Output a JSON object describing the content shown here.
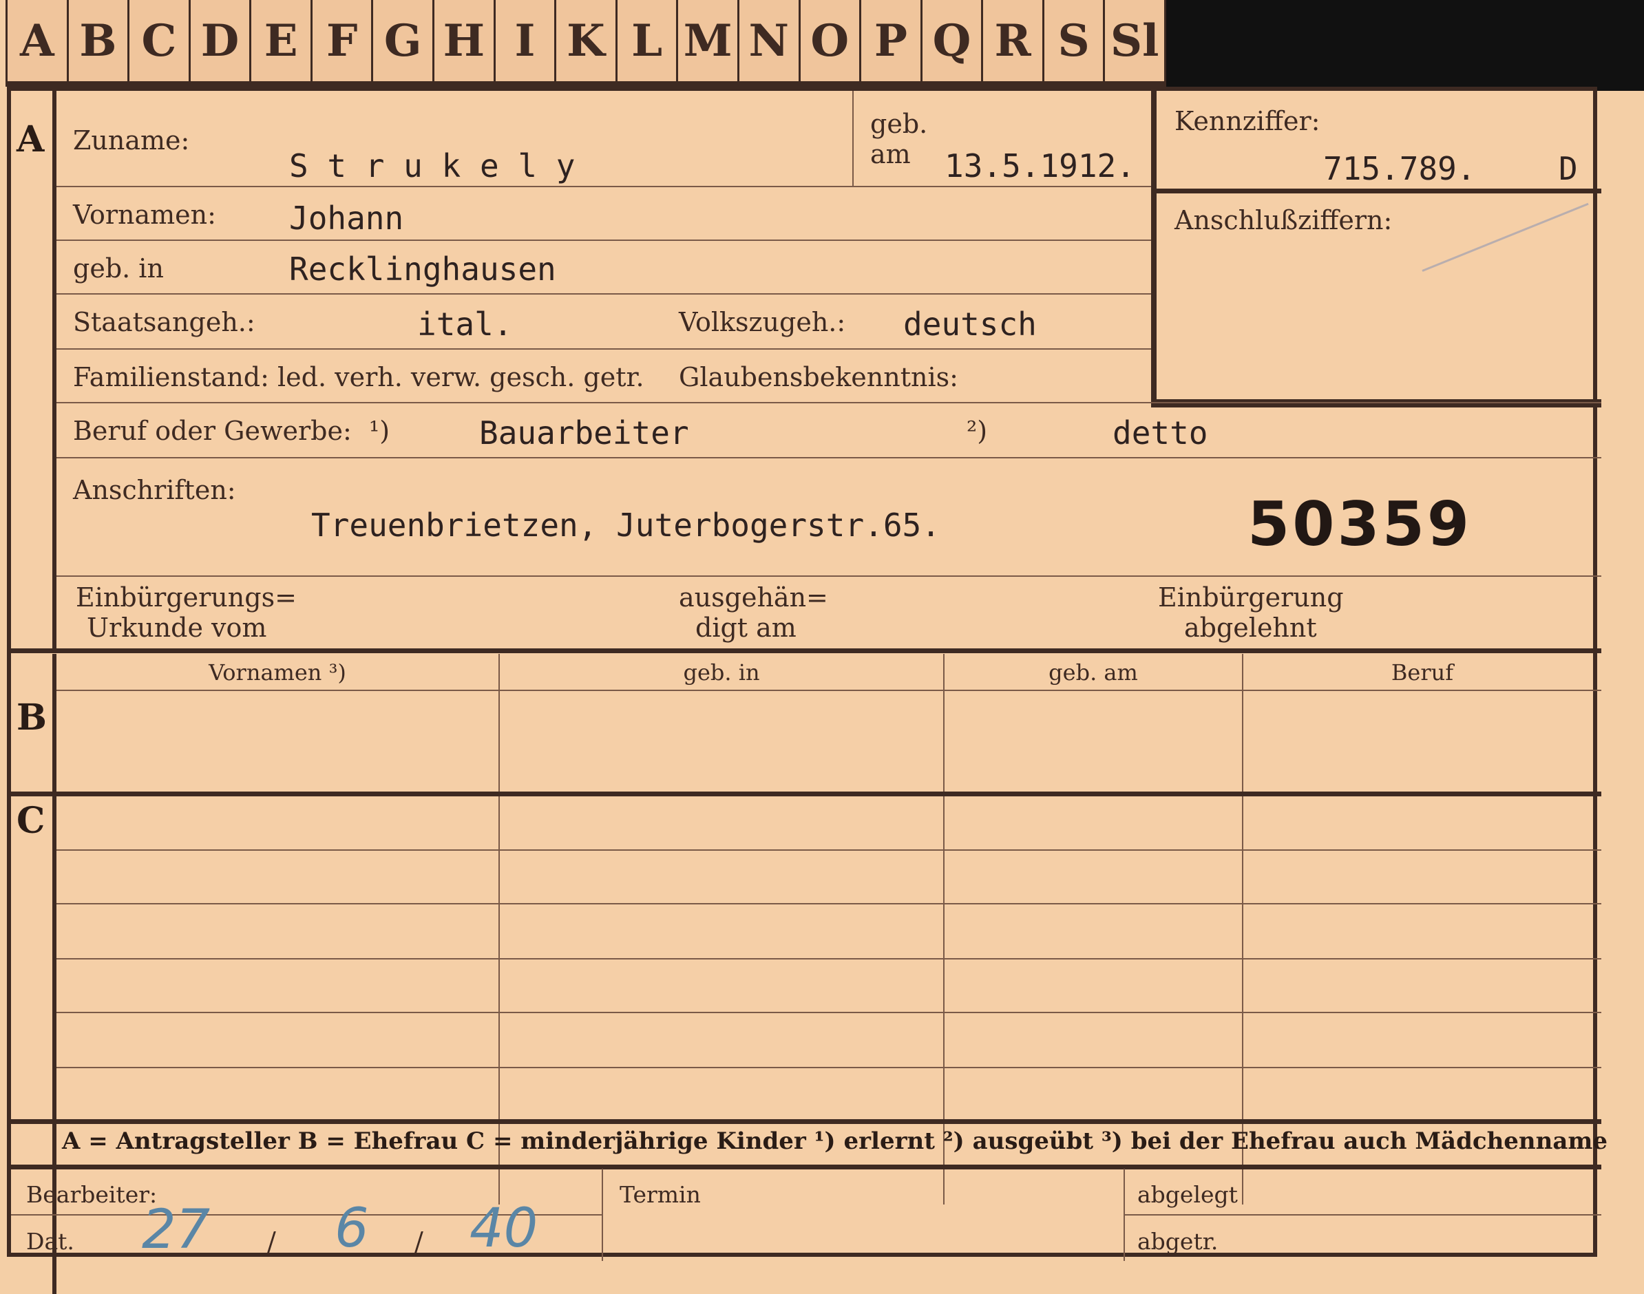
{
  "tabs": [
    "A",
    "B",
    "C",
    "D",
    "E",
    "F",
    "G",
    "H",
    "I",
    "K",
    "L",
    "M",
    "N",
    "O",
    "P",
    "Q",
    "R",
    "S",
    "Sl"
  ],
  "section_a": {
    "marker": "A",
    "zuname_label": "Zuname:",
    "zuname": "S t r u k e l y",
    "geb_label": "geb.",
    "am_label": "am",
    "geb_am": "13.5.1912.",
    "kennziffer_label": "Kennziffer:",
    "kennziffer": "715.789.",
    "kennziffer_suffix": "D",
    "anschluss_label": "Anschlußziffern:",
    "vornamen_label": "Vornamen:",
    "vornamen": "Johann",
    "geb_in_label": "geb. in",
    "geb_in": "Recklinghausen",
    "staatsangeh_label": "Staatsangeh.:",
    "staatsangeh": "ital.",
    "volkszugeh_label": "Volkszugeh.:",
    "volkszugeh": "deutsch",
    "familienstand_label": "Familienstand: led. verh. verw. gesch. getr.",
    "glauben_label": "Glaubensbekenntnis:",
    "beruf_label": "Beruf oder Gewerbe:",
    "beruf_mark1": "¹)",
    "beruf1": "Bauarbeiter",
    "beruf_mark2": "²)",
    "beruf2": "detto",
    "anschriften_label": "Anschriften:",
    "anschrift": "Treuenbrietzen, Juterbogerstr.65.",
    "stamp_number": "50359",
    "einbuerg_label1": "Einbürgerungs=",
    "einbuerg_label2": "Urkunde vom",
    "ausgehaen_label1": "ausgehän=",
    "ausgehaen_label2": "digt am",
    "abgelehnt_label1": "Einbürgerung",
    "abgelehnt_label2": "abgelehnt"
  },
  "section_b": {
    "marker": "B",
    "columns": [
      "Vornamen ³)",
      "geb. in",
      "geb. am",
      "Beruf"
    ]
  },
  "section_c": {
    "marker": "C"
  },
  "legend": "A = Antragsteller   B = Ehefrau   C = minderjährige Kinder   ¹) erlernt   ²) ausgeübt   ³) bei der Ehefrau auch Mädchenname",
  "footer": {
    "bearbeiter_label": "Bearbeiter:",
    "dat_label": "Dat.",
    "dat_day": "27",
    "dat_month": "6",
    "dat_year": "40",
    "sep": "/",
    "termin_label": "Termin",
    "abgelegt_label": "abgelegt",
    "abgetr_label": "abgetr."
  }
}
